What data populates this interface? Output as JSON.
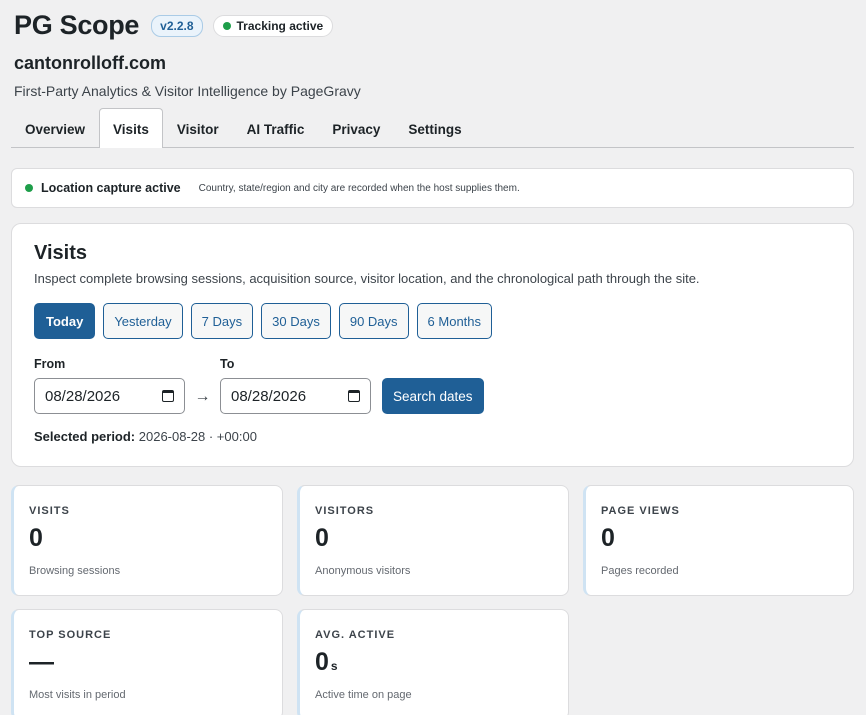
{
  "header": {
    "title": "PG Scope",
    "version": "v2.2.8",
    "tracking": "Tracking active"
  },
  "site": {
    "name": "cantonrolloff.com",
    "subtitle": "First-Party Analytics & Visitor Intelligence by PageGravy"
  },
  "tabs": [
    {
      "label": "Overview"
    },
    {
      "label": "Visits"
    },
    {
      "label": "Visitor"
    },
    {
      "label": "AI Traffic"
    },
    {
      "label": "Privacy"
    },
    {
      "label": "Settings"
    }
  ],
  "notice": {
    "title": "Location capture active",
    "text": "Country, state/region and city are recorded when the host supplies them."
  },
  "visits": {
    "title": "Visits",
    "description": "Inspect complete browsing sessions, acquisition source, visitor location, and the chronological path through the site.",
    "ranges": [
      "Today",
      "Yesterday",
      "7 Days",
      "30 Days",
      "90 Days",
      "6 Months"
    ],
    "from_label": "From",
    "to_label": "To",
    "from_value": "08/28/2026",
    "to_value": "08/28/2026",
    "arrow": "→",
    "search_label": "Search dates",
    "period_label": "Selected period:",
    "period_value": " 2026-08-28 · +00:00"
  },
  "stats": [
    {
      "label": "VISITS",
      "value": "0",
      "unit": "",
      "sub": "Browsing sessions"
    },
    {
      "label": "VISITORS",
      "value": "0",
      "unit": "",
      "sub": "Anonymous visitors"
    },
    {
      "label": "PAGE VIEWS",
      "value": "0",
      "unit": "",
      "sub": "Pages recorded"
    },
    {
      "label": "TOP SOURCE",
      "value": "—",
      "unit": "",
      "sub": "Most visits in period"
    },
    {
      "label": "AVG. ACTIVE",
      "value": "0",
      "unit": "s",
      "sub": "Active time on page"
    }
  ],
  "colors": {
    "accent": "#1f5f96",
    "status_green": "#1e9e4a"
  }
}
